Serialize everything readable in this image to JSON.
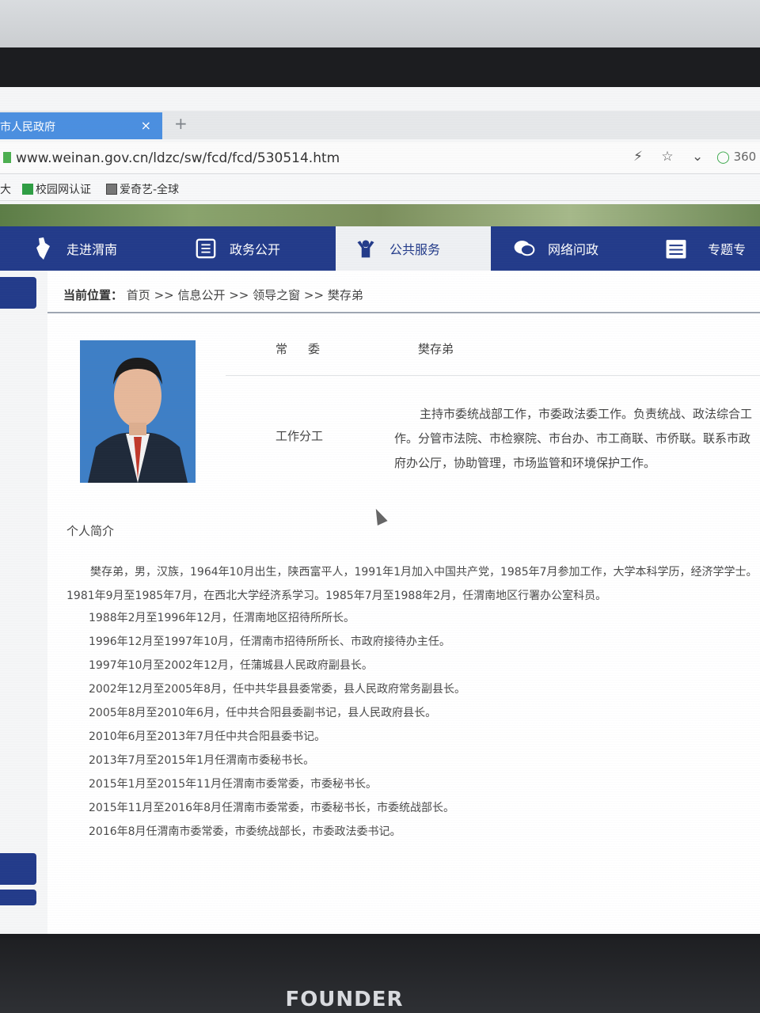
{
  "browser": {
    "tab_title": "市人民政府",
    "tab_close": "×",
    "tab_new": "+",
    "url": "www.weinan.gov.cn/ldzc/sw/fcd/fcd/530514.htm",
    "search_engine": "360",
    "bookmarks": [
      {
        "label": "大"
      },
      {
        "label": "校园网认证"
      },
      {
        "label": "爱奇艺-全球"
      }
    ]
  },
  "nav": {
    "items": [
      {
        "label": "走进渭南",
        "icon": "map-icon",
        "active": false
      },
      {
        "label": "政务公开",
        "icon": "document-icon",
        "active": false
      },
      {
        "label": "公共服务",
        "icon": "people-icon",
        "active": true
      },
      {
        "label": "网络问政",
        "icon": "chat-icon",
        "active": false
      },
      {
        "label": "专题专",
        "icon": "list-icon",
        "active": false
      }
    ]
  },
  "breadcrumb": {
    "prefix": "当前位置：",
    "path": "首页 >> 信息公开 >> 领导之窗 >> 樊存弟"
  },
  "profile": {
    "title_label": "常委",
    "name": "樊存弟",
    "duty_label": "工作分工",
    "duty_text": "主持市委统战部工作，市委政法委工作。负责统战、政法综合工作。分管市法院、市检察院、市台办、市工商联、市侨联。联系市政府办公厅，协助管理，市场监管和环境保护工作。"
  },
  "intro": {
    "heading": "个人简介",
    "lead": "樊存弟，男，汉族，1964年10月出生，陕西富平人，1991年1月加入中国共产党，1985年7月参加工作，大学本科学历，经济学学士。1981年9月至1985年7月，在西北大学经济系学习。1985年7月至1988年2月，任渭南地区行署办公室科员。",
    "items": [
      "1988年2月至1996年12月，任渭南地区招待所所长。",
      "1996年12月至1997年10月，任渭南市招待所所长、市政府接待办主任。",
      "1997年10月至2002年12月，任蒲城县人民政府副县长。",
      "2002年12月至2005年8月，任中共华县县委常委，县人民政府常务副县长。",
      "2005年8月至2010年6月，任中共合阳县委副书记，县人民政府县长。",
      "2010年6月至2013年7月任中共合阳县委书记。",
      "2013年7月至2015年1月任渭南市委秘书长。",
      "2015年1月至2015年11月任渭南市委常委，市委秘书长。",
      "2015年11月至2016年8月任渭南市委常委，市委秘书长，市委统战部长。",
      "2016年8月任渭南市委常委，市委统战部长，市委政法委书记。"
    ]
  },
  "monitor": {
    "brand": "FOUNDER"
  }
}
